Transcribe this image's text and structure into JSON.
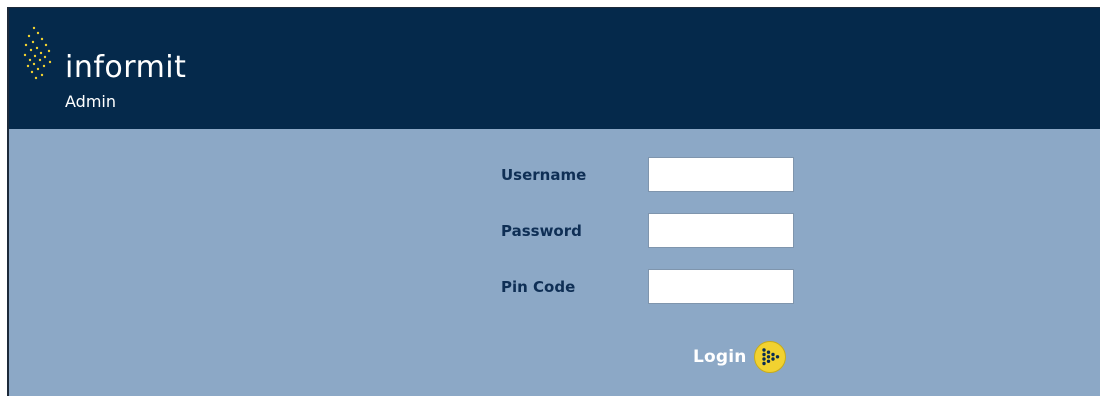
{
  "header": {
    "logo_text": "informit",
    "logo_subtitle": "Admin",
    "logo_dot_color": "#f2d230"
  },
  "form": {
    "username_label": "Username",
    "username_value": "",
    "password_label": "Password",
    "password_value": "",
    "pincode_label": "Pin Code",
    "pincode_value": "",
    "login_label": "Login"
  },
  "colors": {
    "header_bg": "#05294b",
    "content_bg": "#8ca8c6",
    "label_text": "#0f2f55",
    "accent_yellow": "#f2d230"
  },
  "icons": {
    "login": "play-arrow-dots-icon",
    "logo": "dot-grid-icon"
  }
}
